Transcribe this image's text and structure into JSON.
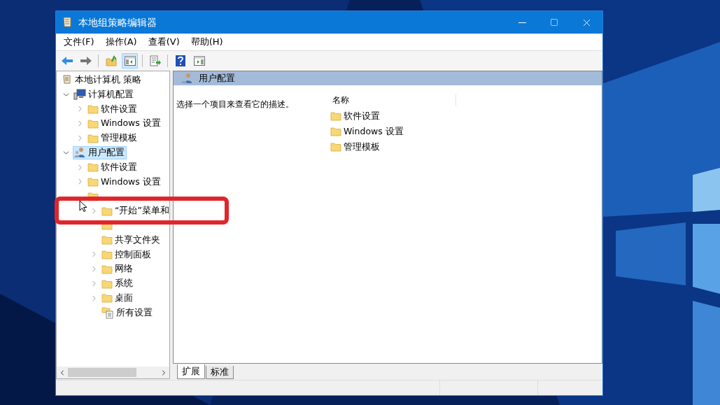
{
  "window": {
    "title": "本地组策略编辑器"
  },
  "menu": [
    "文件(F)",
    "操作(A)",
    "查看(V)",
    "帮助(H)"
  ],
  "toolbar": [
    {
      "kind": "back",
      "pressed": false
    },
    {
      "kind": "forward",
      "pressed": false
    },
    {
      "kind": "sep"
    },
    {
      "kind": "up",
      "pressed": false
    },
    {
      "kind": "tree",
      "pressed": true
    },
    {
      "kind": "sep"
    },
    {
      "kind": "export",
      "pressed": false
    },
    {
      "kind": "sep"
    },
    {
      "kind": "help",
      "pressed": false
    },
    {
      "kind": "pane",
      "pressed": false
    }
  ],
  "tree": {
    "label": "本地计算机 策略",
    "kind": "policy",
    "selected": false,
    "children": [
      {
        "label": "计算机配置",
        "kind": "computer",
        "expanded": true,
        "selected": false,
        "children": [
          {
            "label": "软件设置",
            "kind": "folder",
            "expanded": false,
            "selected": false
          },
          {
            "label": "Windows 设置",
            "kind": "folder",
            "expanded": false,
            "selected": false
          },
          {
            "label": "管理模板",
            "kind": "folder",
            "expanded": false,
            "selected": false
          }
        ]
      },
      {
        "label": "用户配置",
        "kind": "user",
        "expanded": true,
        "selected": true,
        "children": [
          {
            "label": "软件设置",
            "kind": "folder",
            "expanded": false,
            "selected": false
          },
          {
            "label": "Windows 设置",
            "kind": "folder",
            "expanded": false,
            "selected": false
          },
          {
            "kind": "folder",
            "selected": false,
            "children": [
              {
                "label": "“开始”菜单和",
                "kind": "folder",
                "expanded": false,
                "selected": false
              },
              {
                "kind": "folder",
                "selected": false
              },
              {
                "label": "共享文件夹",
                "kind": "folder",
                "selected": false
              },
              {
                "label": "控制面板",
                "kind": "folder",
                "expanded": false,
                "selected": false
              },
              {
                "label": "网络",
                "kind": "folder",
                "expanded": false,
                "selected": false
              },
              {
                "label": "系统",
                "kind": "folder",
                "expanded": false,
                "selected": false
              },
              {
                "label": "桌面",
                "kind": "folder",
                "expanded": false,
                "selected": false
              },
              {
                "label": "所有设置",
                "kind": "settings",
                "selected": false
              }
            ]
          }
        ]
      }
    ]
  },
  "details": {
    "header": "用户配置",
    "description": "选择一个项目来查看它的描述。",
    "column": "名称",
    "items": [
      "软件设置",
      "Windows 设置",
      "管理模板"
    ]
  },
  "tabs": [
    {
      "label": "扩展",
      "selected": true
    },
    {
      "label": "标准",
      "selected": false
    }
  ]
}
